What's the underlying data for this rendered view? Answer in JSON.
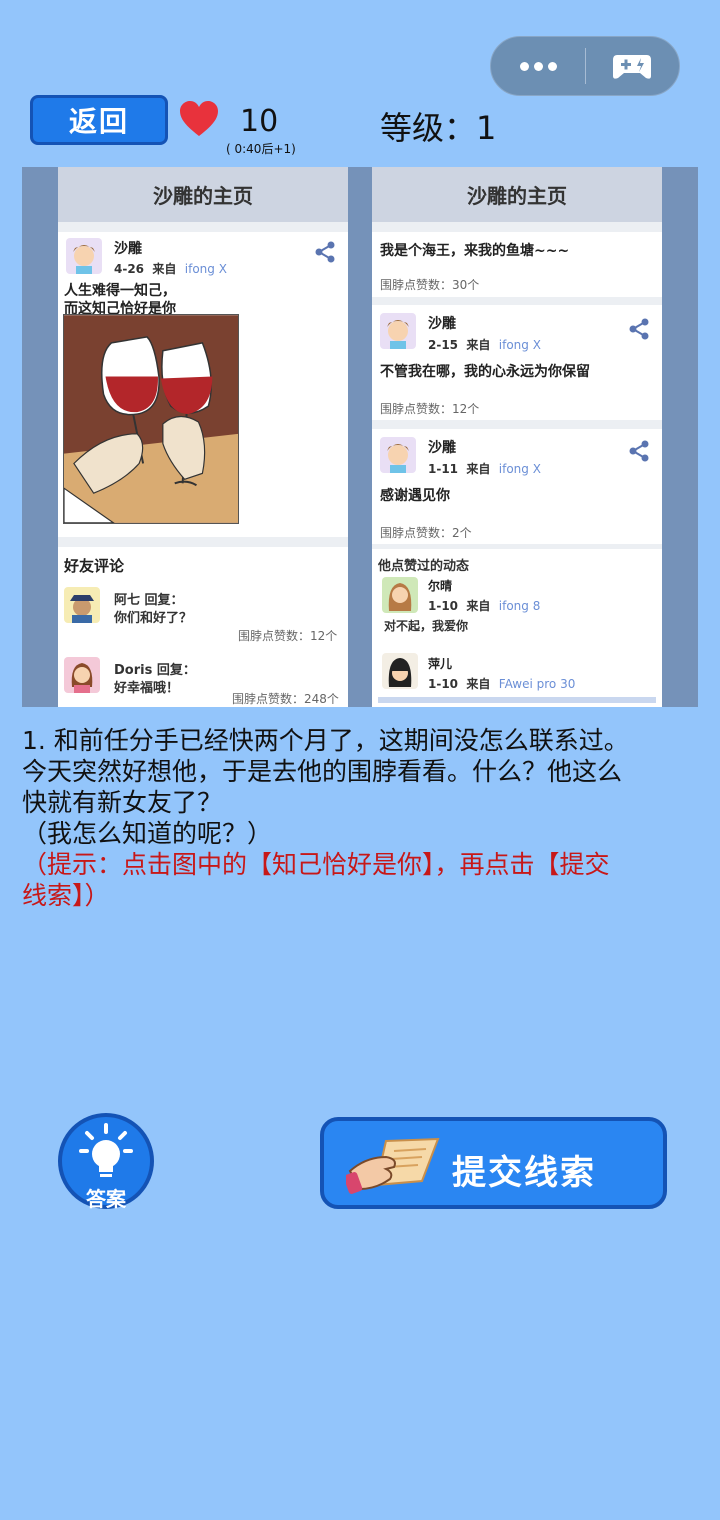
{
  "capsule": {
    "more_icon": "more-dots-icon",
    "game_icon": "gamepad-icon"
  },
  "top_bar": {
    "back_label": "返回",
    "lives": "10",
    "timer": "( 0:40后+1)",
    "level_label": "等级：1"
  },
  "screenshot": {
    "left_panel": {
      "header": "沙雕的主页",
      "post": {
        "user": "沙雕",
        "date": "4-26",
        "via": "来自",
        "device": "ifong X",
        "line1": "人生难得一知己，",
        "line2": "而这知己恰好是你"
      },
      "comments_header": "好友评论",
      "comments": [
        {
          "user_reply": "阿七 回复：",
          "text": "你们和好了？",
          "likes": "围脖点赞数：12个"
        },
        {
          "user_reply": "Doris 回复：",
          "text": "好幸福哦！",
          "likes": "围脖点赞数：248个"
        }
      ]
    },
    "right_panel": {
      "header": "沙雕的主页",
      "top_post": {
        "text": "我是个海王，来我的鱼塘~~~",
        "likes": "围脖点赞数：30个"
      },
      "posts": [
        {
          "user": "沙雕",
          "date": "2-15",
          "via": "来自",
          "device": "ifong X",
          "text": "不管我在哪，我的心永远为你保留",
          "likes": "围脖点赞数：12个"
        },
        {
          "user": "沙雕",
          "date": "1-11",
          "via": "来自",
          "device": "ifong X",
          "text": "感谢遇见你",
          "likes": "围脖点赞数：2个"
        }
      ],
      "liked_header": "他点赞过的动态",
      "liked": [
        {
          "user": "尔晴",
          "date": "1-10",
          "via": "来自",
          "device": "ifong 8",
          "text": "对不起，我爱你"
        },
        {
          "user": "萍儿",
          "date": "1-10",
          "via": "来自",
          "device": "FAwei pro 30"
        }
      ]
    }
  },
  "story": {
    "line1": "1. 和前任分手已经快两个月了，这期间没怎么联系过。",
    "line2": "今天突然好想他，于是去他的围脖看看。什么？他这么",
    "line3": "快就有新女友了？",
    "line4": "（我怎么知道的呢？）",
    "hint1": "（提示：点击图中的【知己恰好是你】，再点击【提交",
    "hint2": "线索】）"
  },
  "buttons": {
    "answer_label": "答案",
    "submit_label": "提交线索"
  },
  "colors": {
    "background": "#93c5fb",
    "button_blue": "#1f7ae9",
    "hint_red": "#c71818"
  }
}
